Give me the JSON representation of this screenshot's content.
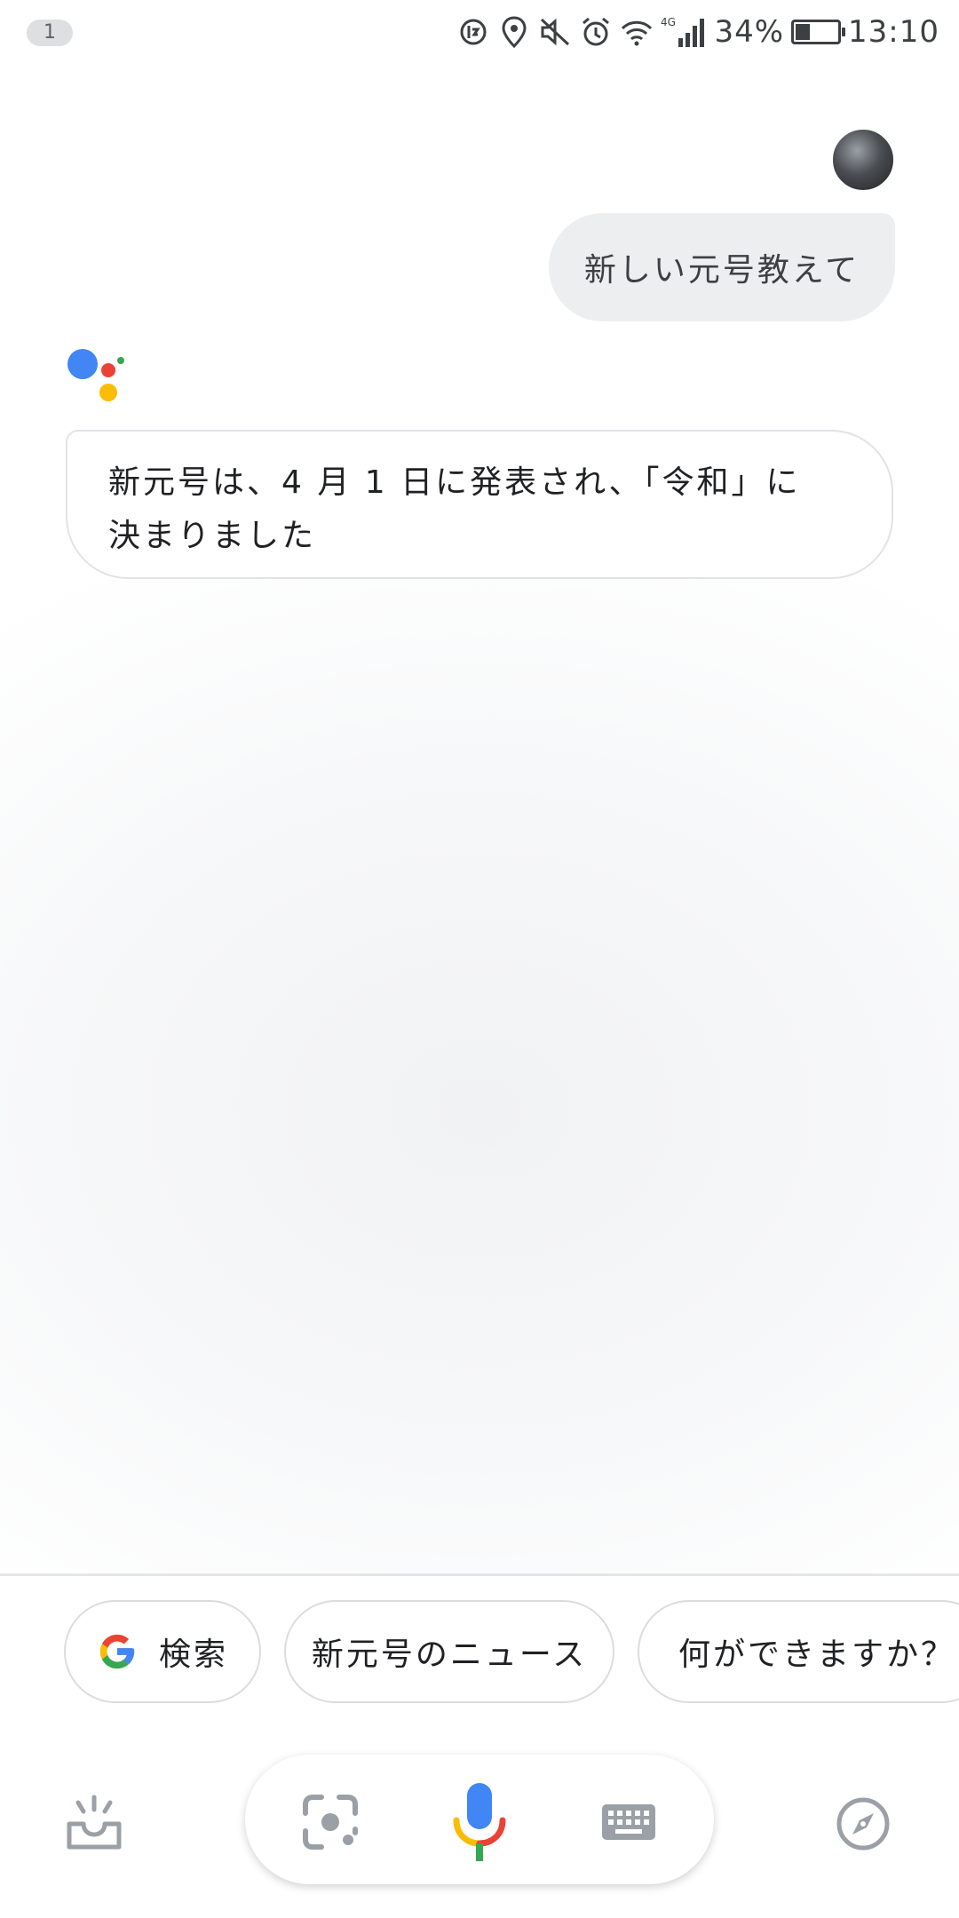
{
  "status_bar": {
    "notification_count": "1",
    "network": "4G",
    "battery_percent": "34%",
    "time": "13:10",
    "battery_level": 0.34,
    "icons": [
      "data-saver-icon",
      "location-icon",
      "mute-icon",
      "alarm-icon",
      "wifi-icon",
      "signal-icon",
      "battery-charging-icon"
    ]
  },
  "conversation": {
    "user_message": "新しい元号教えて",
    "assistant_reply_line1": "新元号は、4 月 1 日に発表され、「令和」に",
    "assistant_reply_line2": "決まりました"
  },
  "suggestions": {
    "search_label": "検索",
    "news_label": "新元号のニュース",
    "what_can_you_do_label": "何ができますか？"
  },
  "toolbar": {
    "icons": [
      "updates-icon",
      "lens-icon",
      "mic-icon",
      "keyboard-icon",
      "explore-compass-icon"
    ]
  },
  "colors": {
    "google_blue": "#4285F4",
    "google_red": "#EA4335",
    "google_yellow": "#FBBC05",
    "google_green": "#34A853",
    "icon_gray": "#9aa0a6"
  }
}
